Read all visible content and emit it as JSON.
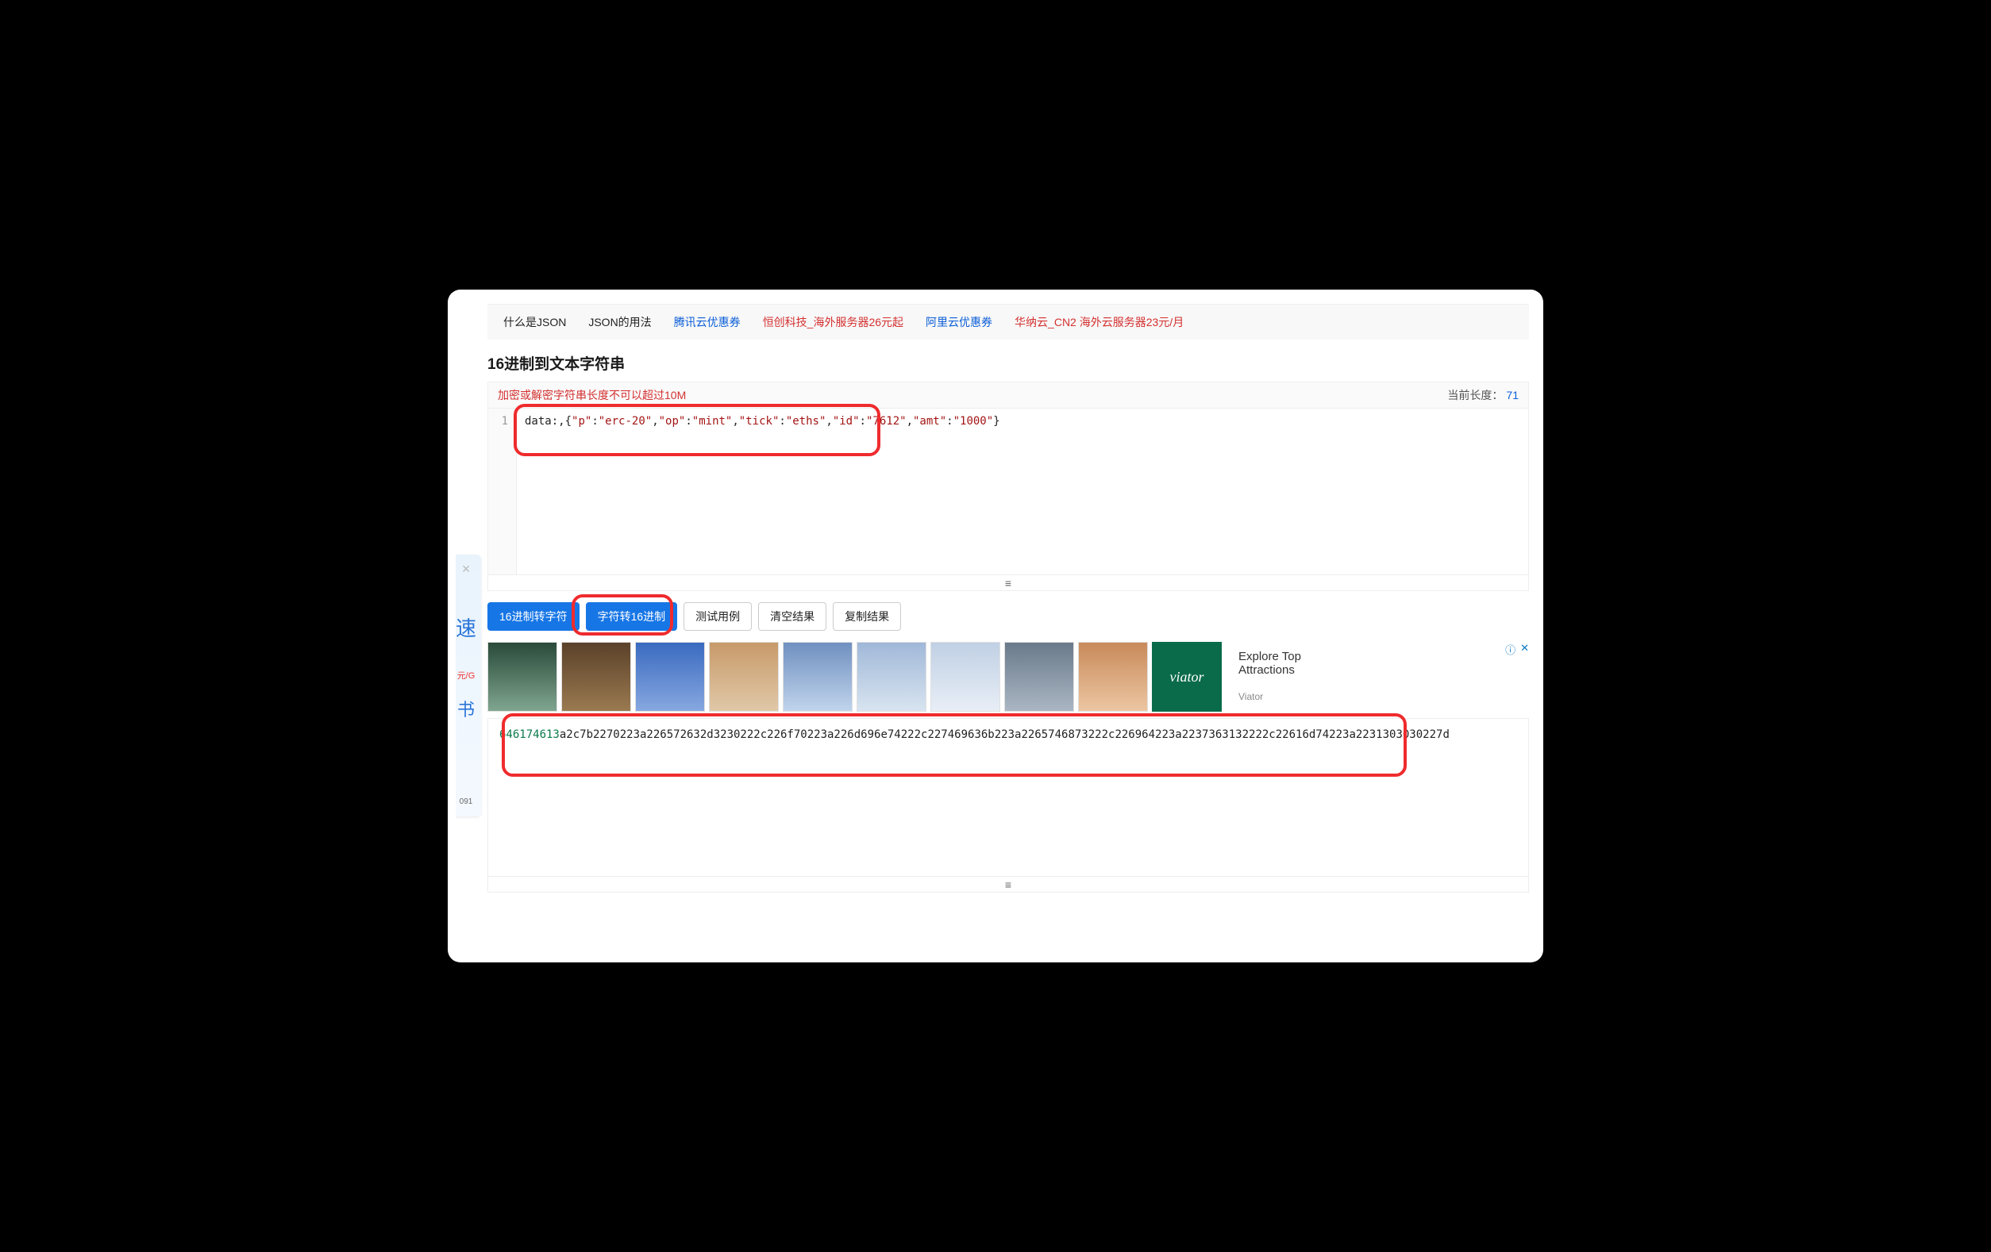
{
  "nav": {
    "items": [
      {
        "label": "什么是JSON",
        "style": "black"
      },
      {
        "label": "JSON的用法",
        "style": "black"
      },
      {
        "label": "腾讯云优惠券",
        "style": "blue"
      },
      {
        "label": "恒创科技_海外服务器26元起",
        "style": "red"
      },
      {
        "label": "阿里云优惠券",
        "style": "blue"
      },
      {
        "label": "华纳云_CN2 海外云服务器23元/月",
        "style": "red"
      }
    ]
  },
  "page_title": "16进制到文本字符串",
  "notice": {
    "warning": "加密或解密字符串长度不可以超过10M",
    "length_label": "当前长度：",
    "length_value": "71"
  },
  "editor": {
    "line_number": "1",
    "prefix": "data:,{",
    "pairs": [
      {
        "k": "\"p\"",
        "v": "\"erc-20\""
      },
      {
        "k": "\"op\"",
        "v": "\"mint\""
      },
      {
        "k": "\"tick\"",
        "v": "\"eths\""
      },
      {
        "k": "\"id\"",
        "v": "\"7612\""
      },
      {
        "k": "\"amt\"",
        "v": "\"1000\""
      }
    ],
    "suffix": "}"
  },
  "buttons": {
    "hex_to_char": "16进制转字符",
    "char_to_hex": "字符转16进制",
    "test_case": "测试用例",
    "clear_result": "清空结果",
    "copy_result": "复制结果"
  },
  "ad": {
    "brand_tile": "viator",
    "headline_l1": "Explore Top",
    "headline_l2": "Attractions",
    "advertiser": "Viator",
    "info_icon": "ⓘ",
    "close_icon": "✕"
  },
  "output": {
    "prefix_digits": "646174613",
    "rest": "a2c7b2270223a226572632d3230222c226f70223a226d696e74222c227469636b223a2265746873222c226964223a2237363132222c22616d74223a2231303030227d"
  },
  "side_float": {
    "close": "×",
    "speed": "速",
    "price": "元/G",
    "book": "书",
    "num": "091"
  },
  "drag_icon": "≡"
}
